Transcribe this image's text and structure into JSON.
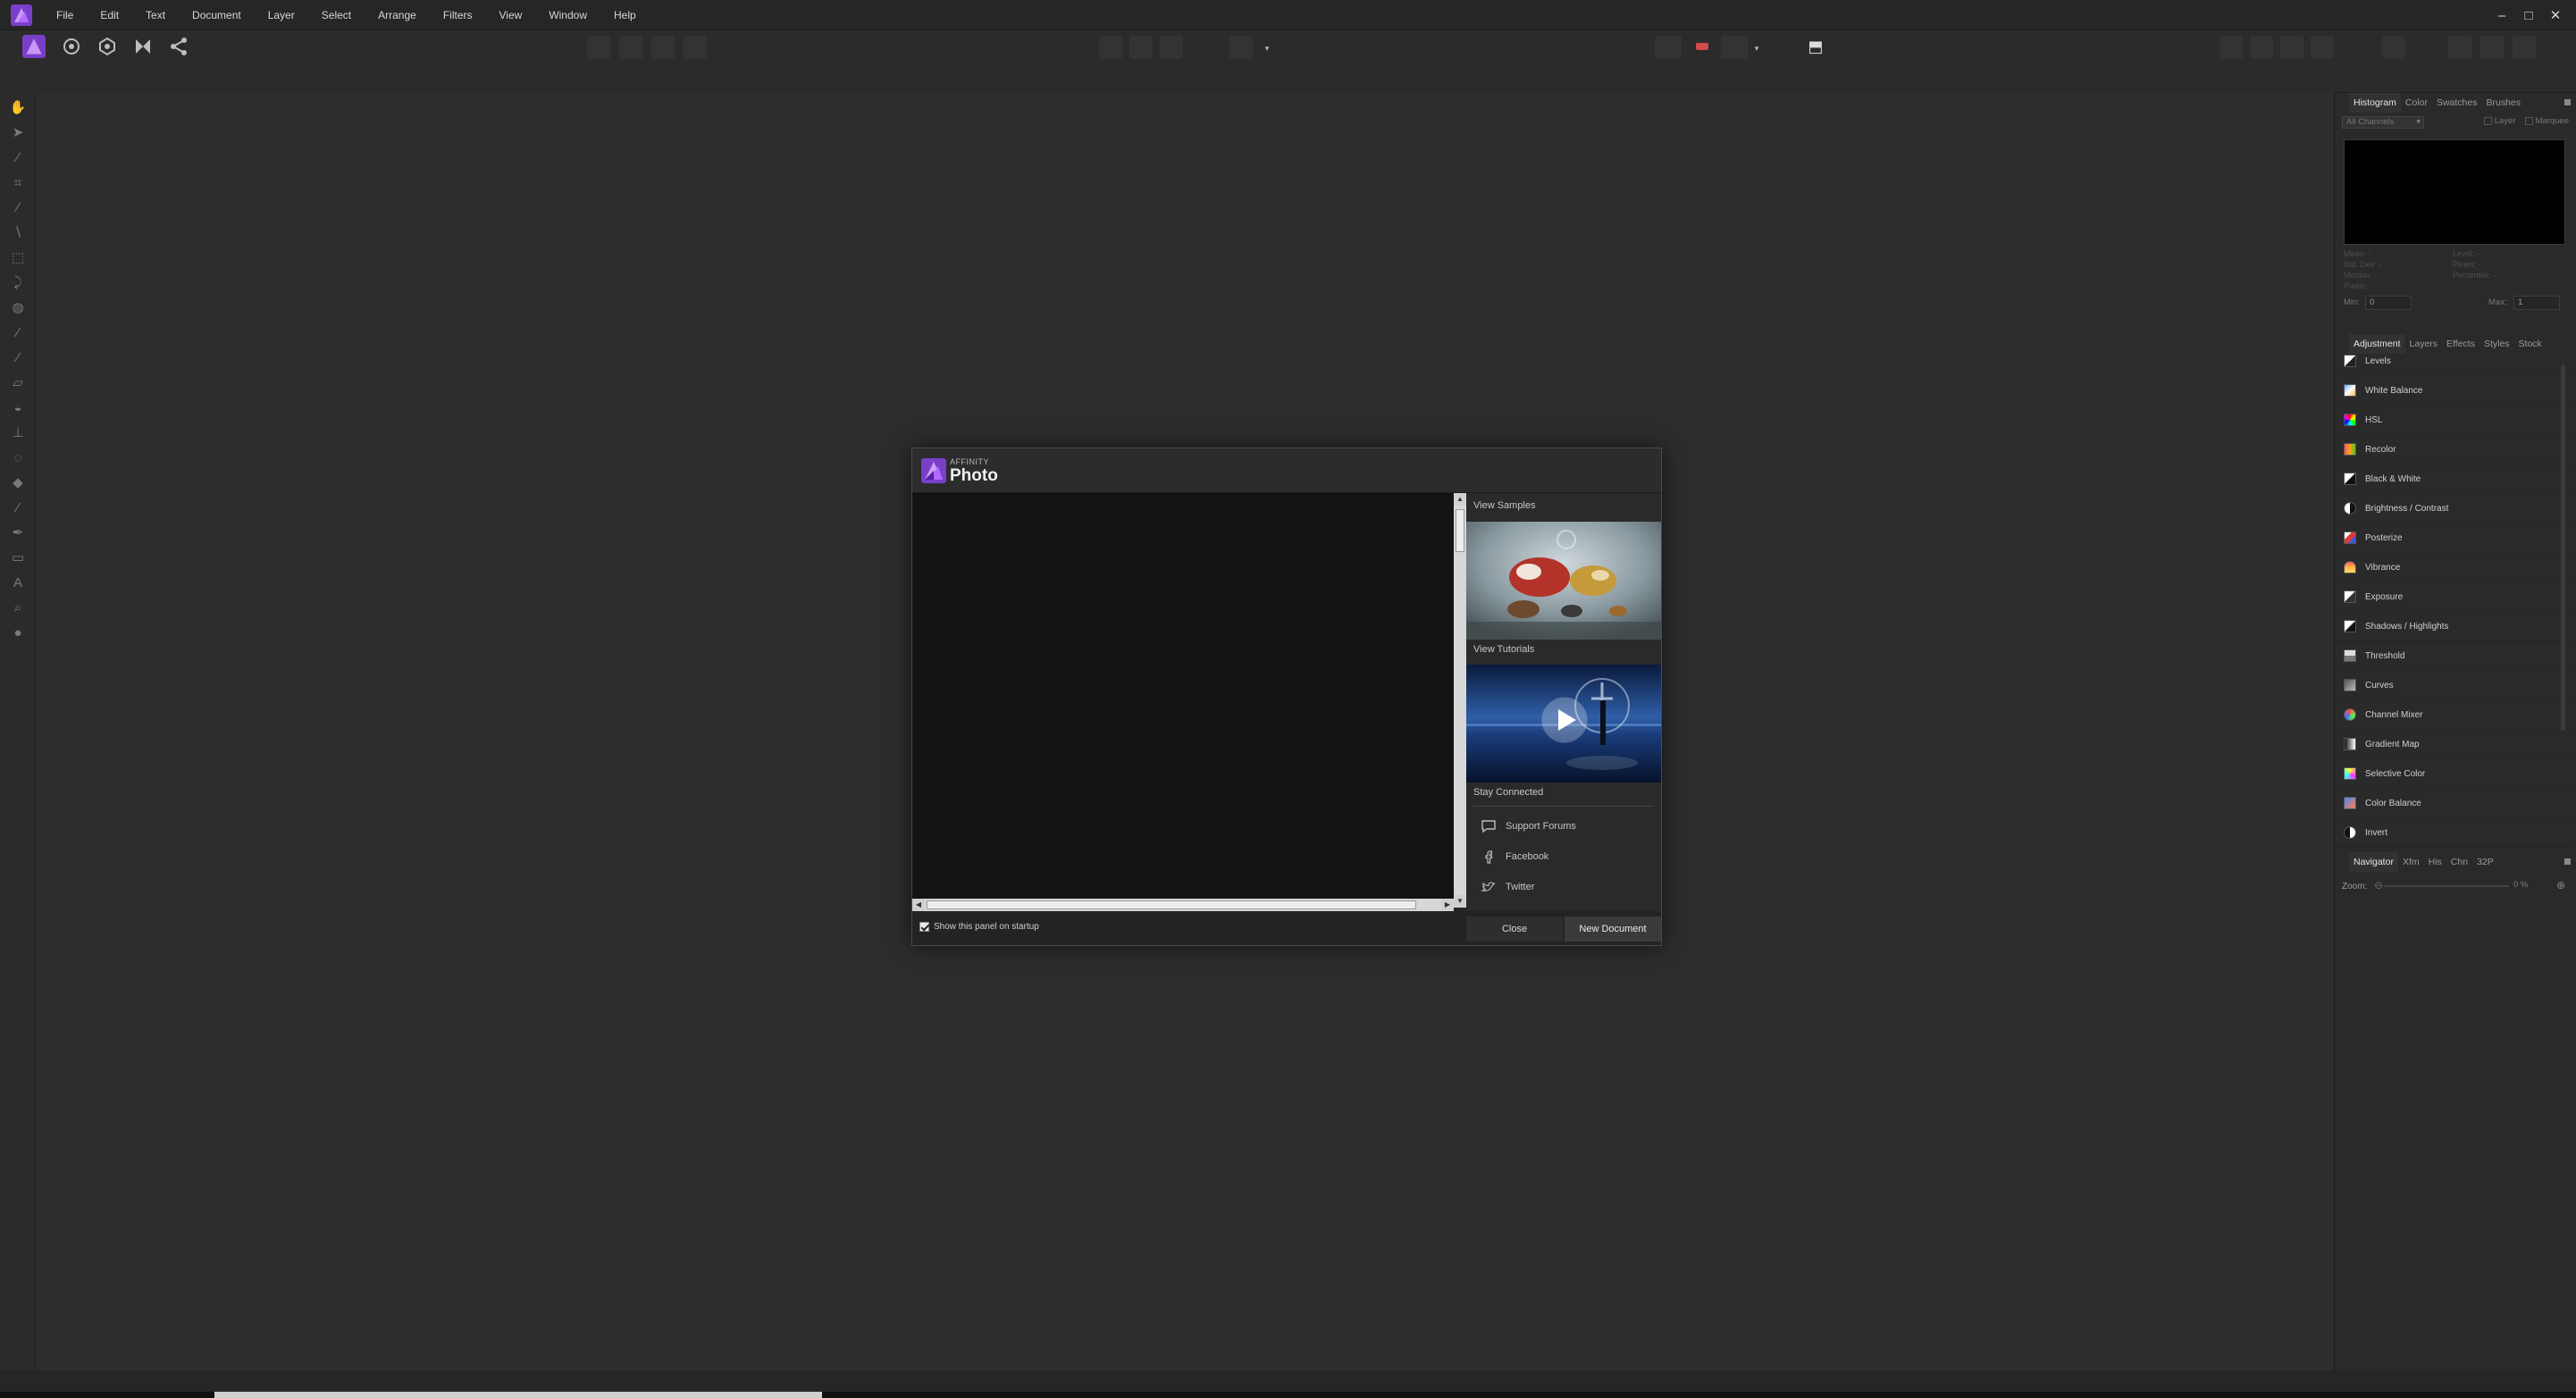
{
  "app": {
    "logo_icon": "affinity-photo-logo-icon",
    "accent": "#a66cff"
  },
  "menubar": {
    "items": [
      "File",
      "Edit",
      "Text",
      "Document",
      "Layer",
      "Select",
      "Arrange",
      "Filters",
      "View",
      "Window",
      "Help"
    ],
    "window_controls": {
      "minimize": "–",
      "maximize": "□",
      "close": "✕"
    }
  },
  "histogram_panel": {
    "tabs": [
      "Histogram",
      "Color",
      "Swatches",
      "Brushes"
    ],
    "channel_select": "All Channels",
    "check_layer": "Layer",
    "check_marquee": "Marquee",
    "stats_left": [
      "Mean: -",
      "Std. Dev: -",
      "Median: -",
      "Pixels: -"
    ],
    "stats_right": [
      "Level: -",
      "Pixels: -",
      "Percentile: -"
    ],
    "min_label": "Min:",
    "min_value": "0",
    "max_label": "Max:",
    "max_value": "1"
  },
  "adjustment_panel": {
    "tabs": [
      "Adjustment",
      "Layers",
      "Effects",
      "Styles",
      "Stock"
    ],
    "items": [
      "Levels",
      "White Balance",
      "HSL",
      "Recolor",
      "Black & White",
      "Brightness / Contrast",
      "Posterize",
      "Vibrance",
      "Exposure",
      "Shadows / Highlights",
      "Threshold",
      "Curves",
      "Channel Mixer",
      "Gradient Map",
      "Selective Color",
      "Color Balance",
      "Invert"
    ]
  },
  "navigator_panel": {
    "tabs": [
      "Navigator",
      "Xfm",
      "His",
      "Chn",
      "32P"
    ],
    "zoom_label": "Zoom:",
    "zoom_value": "0 %"
  },
  "dialog": {
    "brand_small": "AFFINITY",
    "brand_big": "Photo",
    "view_samples": "View Samples",
    "view_tutorials": "View Tutorials",
    "stay_connected": "Stay Connected",
    "links": [
      "Support Forums",
      "Facebook",
      "Twitter"
    ],
    "show_on_startup": "Show this panel on startup",
    "close_button": "Close",
    "new_document_button": "New Document"
  }
}
